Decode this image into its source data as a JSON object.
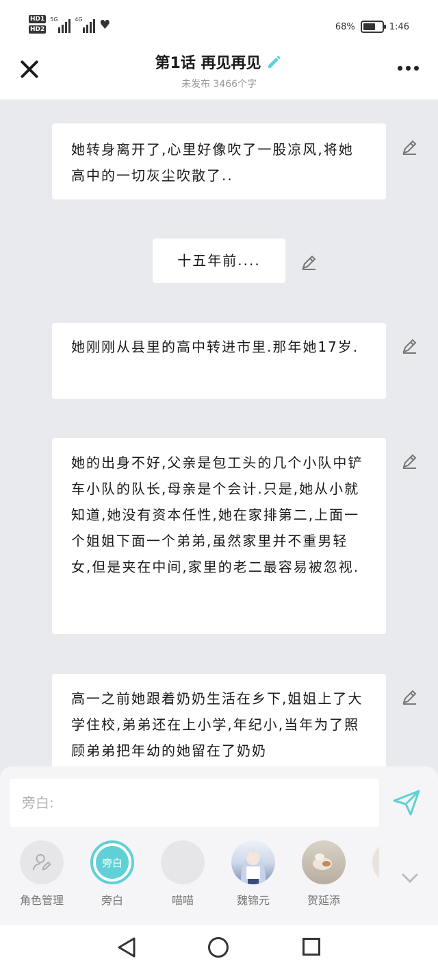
{
  "status_bar": {
    "hd1": "HD1",
    "hd2": "HD2",
    "sig1_label": "5G",
    "sig2_label": "4G",
    "battery_pct": "68%",
    "battery_level": 0.68,
    "time": "1:46"
  },
  "header": {
    "title": "第1话 再见再见",
    "subtitle": "未发布 3466个字",
    "accent_color": "#5fd0d6"
  },
  "cards": [
    {
      "text": "她转身离开了,心里好像吹了一股凉风,将她高中的一切灰尘吹散了.."
    },
    {
      "text": "十五年前...."
    },
    {
      "text": "她刚刚从县里的高中转进市里.那年她17岁."
    },
    {
      "text": "她的出身不好,父亲是包工头的几个小队中铲车小队的队长,母亲是个会计.只是,她从小就知道,她没有资本任性,她在家排第二,上面一个姐姐下面一个弟弟,虽然家里并不重男轻女,但是夹在中间,家里的老二最容易被忽视."
    },
    {
      "text": "高一之前她跟着奶奶生活在乡下,姐姐上了大学住校,弟弟还在上小学,年纪小,当年为了照顾弟弟把年幼的她留在了奶奶"
    }
  ],
  "composer": {
    "placeholder": "旁白:"
  },
  "roles": [
    {
      "label": "角色管理",
      "icon": "user-edit-icon"
    },
    {
      "label": "旁白",
      "avatar_text": "旁白",
      "selected": true
    },
    {
      "label": "喵喵"
    },
    {
      "label": "魏锦元"
    },
    {
      "label": "贺延添"
    }
  ]
}
